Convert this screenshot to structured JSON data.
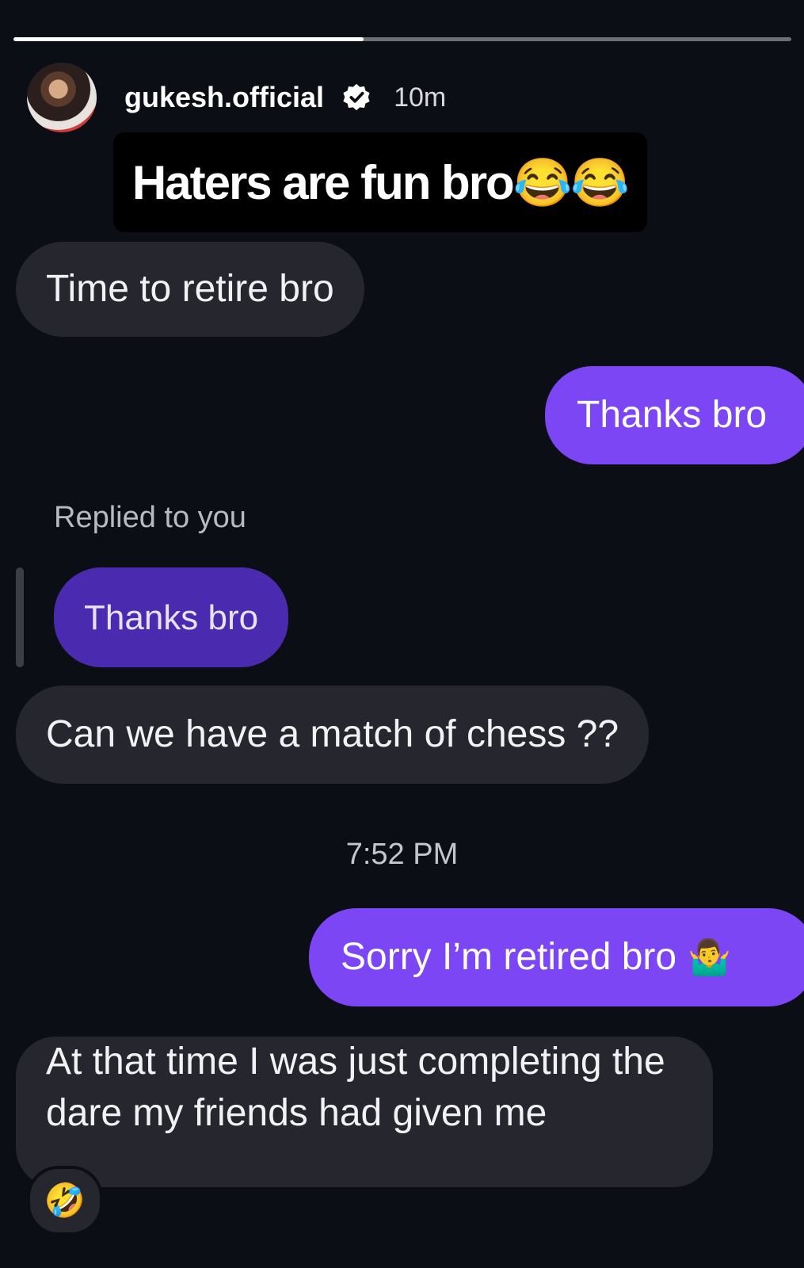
{
  "story": {
    "progress_fraction": 0.45,
    "username": "gukesh.official",
    "verified_icon": "verified-badge-icon",
    "time": "10m",
    "caption": "Haters are fun bro😂😂"
  },
  "messages": {
    "m1": "Time to retire bro",
    "m2": "Thanks bro",
    "replied_label": "Replied to you",
    "quoted": "Thanks bro",
    "m3": "Can we have a match of chess ??",
    "timestamp": "7:52 PM",
    "m4": "Sorry I’m retired bro",
    "m4_emoji": "🤷‍♂️",
    "m5": "At that time I was just completing the dare my friends had given me",
    "reaction_emoji": "🤣"
  },
  "colors": {
    "background": "#0c0e16",
    "received_bubble": "#26272e",
    "sent_bubble": "#7c46f5",
    "quoted_bubble": "#4a2bb0"
  }
}
